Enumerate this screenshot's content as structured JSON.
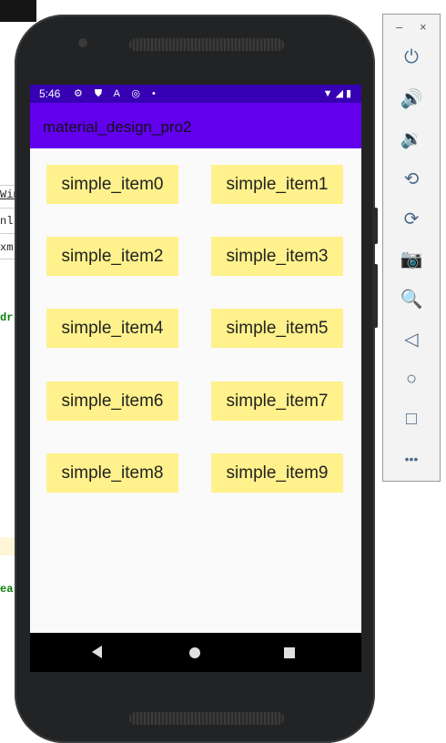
{
  "ide_fragments": [
    "Win",
    "nl",
    "xm",
    "dr",
    "ea"
  ],
  "status_bar": {
    "time": "5:46",
    "left_icons": "⚙ ⛊ A ◎ •",
    "right_icons": "▼◢▮"
  },
  "app": {
    "title": "material_design_pro2",
    "items": [
      "simple_item0",
      "simple_item1",
      "simple_item2",
      "simple_item3",
      "simple_item4",
      "simple_item5",
      "simple_item6",
      "simple_item7",
      "simple_item8",
      "simple_item9"
    ]
  },
  "emulator_toolbar": {
    "minimize": "–",
    "close": "×",
    "buttons": [
      {
        "name": "power-icon",
        "glyph": "⏻"
      },
      {
        "name": "volume-up-icon",
        "glyph": "🔊"
      },
      {
        "name": "volume-down-icon",
        "glyph": "🔉"
      },
      {
        "name": "rotate-left-icon",
        "glyph": "⟲"
      },
      {
        "name": "rotate-right-icon",
        "glyph": "⟳"
      },
      {
        "name": "camera-icon",
        "glyph": "📷"
      },
      {
        "name": "zoom-icon",
        "glyph": "🔍"
      },
      {
        "name": "back-icon",
        "glyph": "◁"
      },
      {
        "name": "home-icon",
        "glyph": "○"
      },
      {
        "name": "overview-icon",
        "glyph": "□"
      },
      {
        "name": "more-icon",
        "glyph": "•••"
      }
    ]
  },
  "colors": {
    "status_bar": "#3700b3",
    "app_bar": "#6200ee",
    "item_background": "#fff18c"
  }
}
